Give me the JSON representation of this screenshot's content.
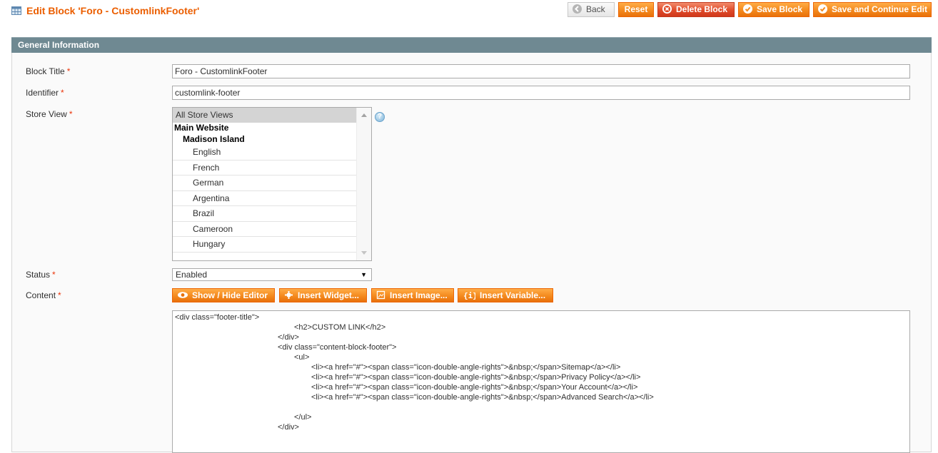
{
  "header": {
    "title": "Edit Block 'Foro - CustomlinkFooter'",
    "title_icon": "grid-icon",
    "buttons": {
      "back": "Back",
      "reset": "Reset",
      "delete": "Delete Block",
      "save": "Save Block",
      "save_continue": "Save and Continue Edit"
    }
  },
  "section": {
    "title": "General Information"
  },
  "fields": {
    "block_title": {
      "label": "Block Title",
      "required_mark": "*",
      "value": "Foro - CustomlinkFooter"
    },
    "identifier": {
      "label": "Identifier",
      "required_mark": "*",
      "value": "customlink-footer"
    },
    "store_view": {
      "label": "Store View",
      "required_mark": "*",
      "options": {
        "all": "All Store Views",
        "website": "Main Website",
        "store": "Madison Island",
        "views": [
          "English",
          "French",
          "German",
          "Argentina",
          "Brazil",
          "Cameroon",
          "Hungary"
        ]
      },
      "selected": "All Store Views"
    },
    "status": {
      "label": "Status",
      "required_mark": "*",
      "value": "Enabled"
    },
    "content": {
      "label": "Content",
      "required_mark": "*",
      "buttons": {
        "toggle": "Show / Hide Editor",
        "widget": "Insert Widget...",
        "image": "Insert Image...",
        "variable": "Insert Variable..."
      },
      "lines": [
        "<div class=\"footer-title\">",
        "<h2>CUSTOM LINK</h2>",
        "</div>",
        "<div class=\"content-block-footer\">",
        "<ul>",
        "<li><a href=\"#\"><span class=\"icon-double-angle-rights\">&nbsp;</span>Sitemap</a></li>",
        "<li><a href=\"#\"><span class=\"icon-double-angle-rights\">&nbsp;</span>Privacy Policy</a></li>",
        "<li><a href=\"#\"><span class=\"icon-double-angle-rights\">&nbsp;</span>Your Account</a></li>",
        "<li><a href=\"#\"><span class=\"icon-double-angle-rights\">&nbsp;</span>Advanced Search</a></li>",
        "</ul>",
        "</div>"
      ]
    }
  },
  "colors": {
    "title": "#eb5e00",
    "button_orange": "#f48a1e",
    "section_header": "#6f8992",
    "required": "#eb340a"
  }
}
